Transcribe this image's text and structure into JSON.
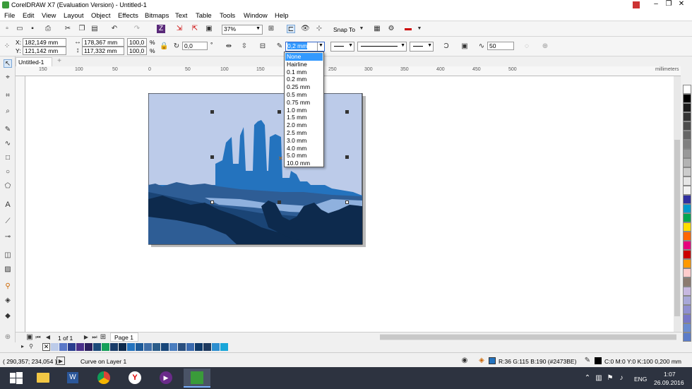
{
  "title_bar": {
    "title": "CorelDRAW X7 (Evaluation Version) - Untitled-1"
  },
  "menu": [
    "File",
    "Edit",
    "View",
    "Layout",
    "Object",
    "Effects",
    "Bitmaps",
    "Text",
    "Table",
    "Tools",
    "Window",
    "Help"
  ],
  "standard_toolbar": {
    "zoom": "37%",
    "snap_to": "Snap To"
  },
  "property_bar": {
    "x": "182,149 mm",
    "y": "121,142 mm",
    "width": "178,367 mm",
    "height": "117,332 mm",
    "scale_x": "100,0",
    "scale_y": "100,0",
    "pct": "%",
    "rotation": "0,0",
    "deg": "°",
    "outline_width": "0,2 mm",
    "smoothing": "50"
  },
  "document_tab": "Untitled-1",
  "ruler": {
    "ticks": [
      "150",
      "100",
      "50",
      "0",
      "50",
      "100",
      "150",
      "200",
      "250",
      "300",
      "350",
      "400",
      "450",
      "500"
    ],
    "unit": "millimeters"
  },
  "outline_width_options": [
    "None",
    "Hairline",
    "0.1 mm",
    "0.2 mm",
    "0.25 mm",
    "0.5 mm",
    "0.75 mm",
    "1.0 mm",
    "1.5 mm",
    "2.0 mm",
    "2.5 mm",
    "3.0 mm",
    "4.0 mm",
    "5.0 mm",
    "10.0 mm"
  ],
  "outline_selected_index": 0,
  "page_nav": {
    "counter": "1 of 1",
    "page_tab": "Page 1"
  },
  "status": {
    "coords": "( 290,357; 234,054 )",
    "object": "Curve on Layer 1",
    "fill": "R:36 G:115 B:190 (#2473BE)",
    "outline": "C:0 M:0 Y:0 K:100  0,200 mm"
  },
  "taskbar": {
    "lang": "ENG",
    "time": "1:07",
    "date": "26.09.2016"
  },
  "colors": {
    "sky": "#bccbe9",
    "city": "#2473be",
    "dark": "#0d2a4d",
    "mid": "#2e5d95",
    "water": "#8fb1de",
    "palette": [
      "#ffffff",
      "#000000",
      "#1a1a1a",
      "#333333",
      "#4d4d4d",
      "#666666",
      "#808080",
      "#999999",
      "#b3b3b3",
      "#cccccc",
      "#e6e6e6",
      "#f2f2f2",
      "#3030a0",
      "#0099cc",
      "#00a651",
      "#ffdd00",
      "#ff6600",
      "#e6007e",
      "#cc0000",
      "#ff9900",
      "#ffcccc",
      "#8c7b70",
      "#c7b8e0",
      "#a8a8d8",
      "#9090d0",
      "#7878c8",
      "#6a8bd0",
      "#5a7bc8"
    ],
    "doc_palette": [
      "#bccbe9",
      "#5a78c8",
      "#2a3d8f",
      "#4a2f8a",
      "#2b1f5e",
      "#1b4a7a",
      "#15a05a",
      "#1a3d6a",
      "#0d2a4d",
      "#2473be",
      "#1d5a99",
      "#3f6ea8",
      "#2b5d8a",
      "#17467a",
      "#4a7dbf",
      "#2a4f7f",
      "#3a6aaf",
      "#0f3a6a",
      "#1e3a5f",
      "#2d8fd0",
      "#18a6d9"
    ]
  }
}
